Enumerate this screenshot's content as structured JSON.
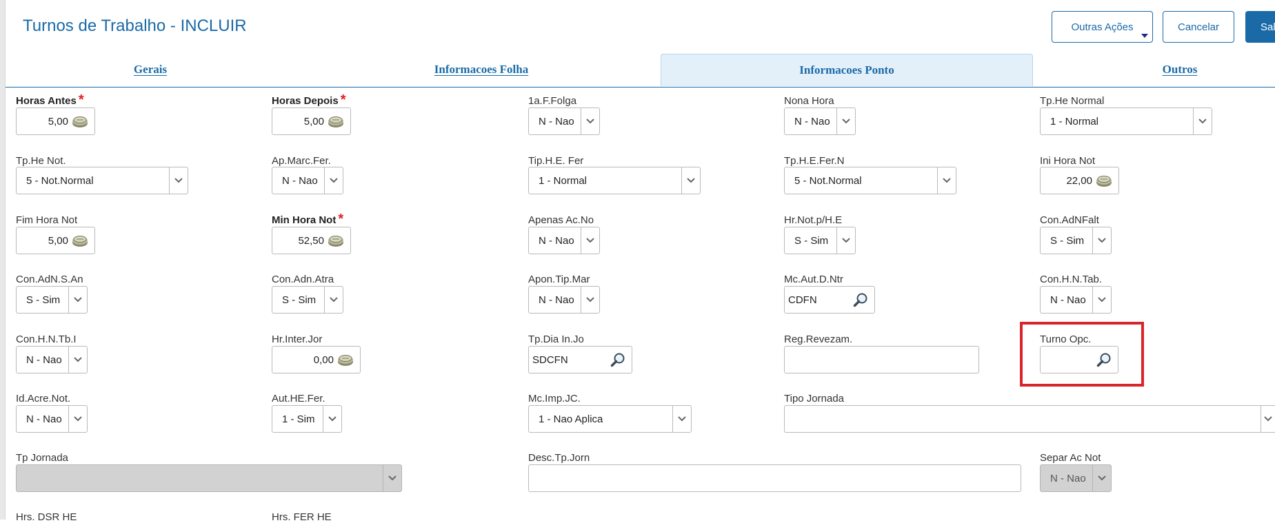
{
  "title": "Turnos de Trabalho - INCLUIR",
  "buttons": {
    "other_actions": "Outras Ações",
    "cancel": "Cancelar",
    "save": "Sal"
  },
  "tabs": [
    {
      "label": "Gerais"
    },
    {
      "label": "Informacoes Folha"
    },
    {
      "label": "Informacoes Ponto"
    },
    {
      "label": "Outros"
    }
  ],
  "fields": {
    "horas_antes": {
      "label": "Horas Antes",
      "value": "5,00"
    },
    "horas_depois": {
      "label": "Horas Depois",
      "value": "5,00"
    },
    "folga": {
      "label": "1a.F.Folga",
      "value": "N - Nao"
    },
    "nona_hora": {
      "label": "Nona Hora",
      "value": "N - Nao"
    },
    "tp_he_normal": {
      "label": "Tp.He Normal",
      "value": "1 - Normal"
    },
    "tp_he_not": {
      "label": "Tp.He Not.",
      "value": "5 - Not.Normal"
    },
    "ap_marc_fer": {
      "label": "Ap.Marc.Fer.",
      "value": "N - Nao"
    },
    "tip_he_fer": {
      "label": "Tip.H.E. Fer",
      "value": "1 - Normal"
    },
    "tp_he_fer_n": {
      "label": "Tp.H.E.Fer.N",
      "value": "5 - Not.Normal"
    },
    "ini_hora_not": {
      "label": "Ini Hora Not",
      "value": "22,00"
    },
    "fim_hora_not": {
      "label": "Fim Hora Not",
      "value": "5,00"
    },
    "min_hora_not": {
      "label": "Min Hora Not",
      "value": "52,50"
    },
    "apenas_ac_no": {
      "label": "Apenas Ac.No",
      "value": "N - Nao"
    },
    "hr_not_ph_e": {
      "label": "Hr.Not.p/H.E",
      "value": "S - Sim"
    },
    "con_adnfalt": {
      "label": "Con.AdNFalt",
      "value": "S - Sim"
    },
    "con_adn_s_an": {
      "label": "Con.AdN.S.An",
      "value": "S - Sim"
    },
    "con_adn_atra": {
      "label": "Con.Adn.Atra",
      "value": "S - Sim"
    },
    "apon_tip_mar": {
      "label": "Apon.Tip.Mar",
      "value": "N - Nao"
    },
    "mc_aut_d_ntr": {
      "label": "Mc.Aut.D.Ntr",
      "value": "CDFN"
    },
    "con_h_n_tab": {
      "label": "Con.H.N.Tab.",
      "value": "N - Nao"
    },
    "con_h_n_tb_i": {
      "label": "Con.H.N.Tb.I",
      "value": "N - Nao"
    },
    "hr_inter_jor": {
      "label": "Hr.Inter.Jor",
      "value": "0,00"
    },
    "tp_dia_in_jo": {
      "label": "Tp.Dia In.Jo",
      "value": "SDCFN"
    },
    "reg_revezam": {
      "label": "Reg.Revezam.",
      "value": ""
    },
    "turno_opc": {
      "label": "Turno Opc.",
      "value": ""
    },
    "id_acre_not": {
      "label": "Id.Acre.Not.",
      "value": "N - Nao"
    },
    "aut_he_fer": {
      "label": "Aut.HE.Fer.",
      "value": "1 - Sim"
    },
    "mc_imp_jc": {
      "label": "Mc.Imp.JC.",
      "value": "1 - Nao Aplica"
    },
    "tipo_jornada": {
      "label": "Tipo Jornada",
      "value": ""
    },
    "tp_jornada": {
      "label": "Tp Jornada",
      "value": ""
    },
    "desc_tp_jorn": {
      "label": "Desc.Tp.Jorn",
      "value": ""
    },
    "separ_ac_not": {
      "label": "Separ Ac Not",
      "value": "N - Nao"
    },
    "hrs_dsr_he": {
      "label": "Hrs. DSR HE"
    },
    "hrs_fer_he": {
      "label": "Hrs. FER HE"
    }
  }
}
